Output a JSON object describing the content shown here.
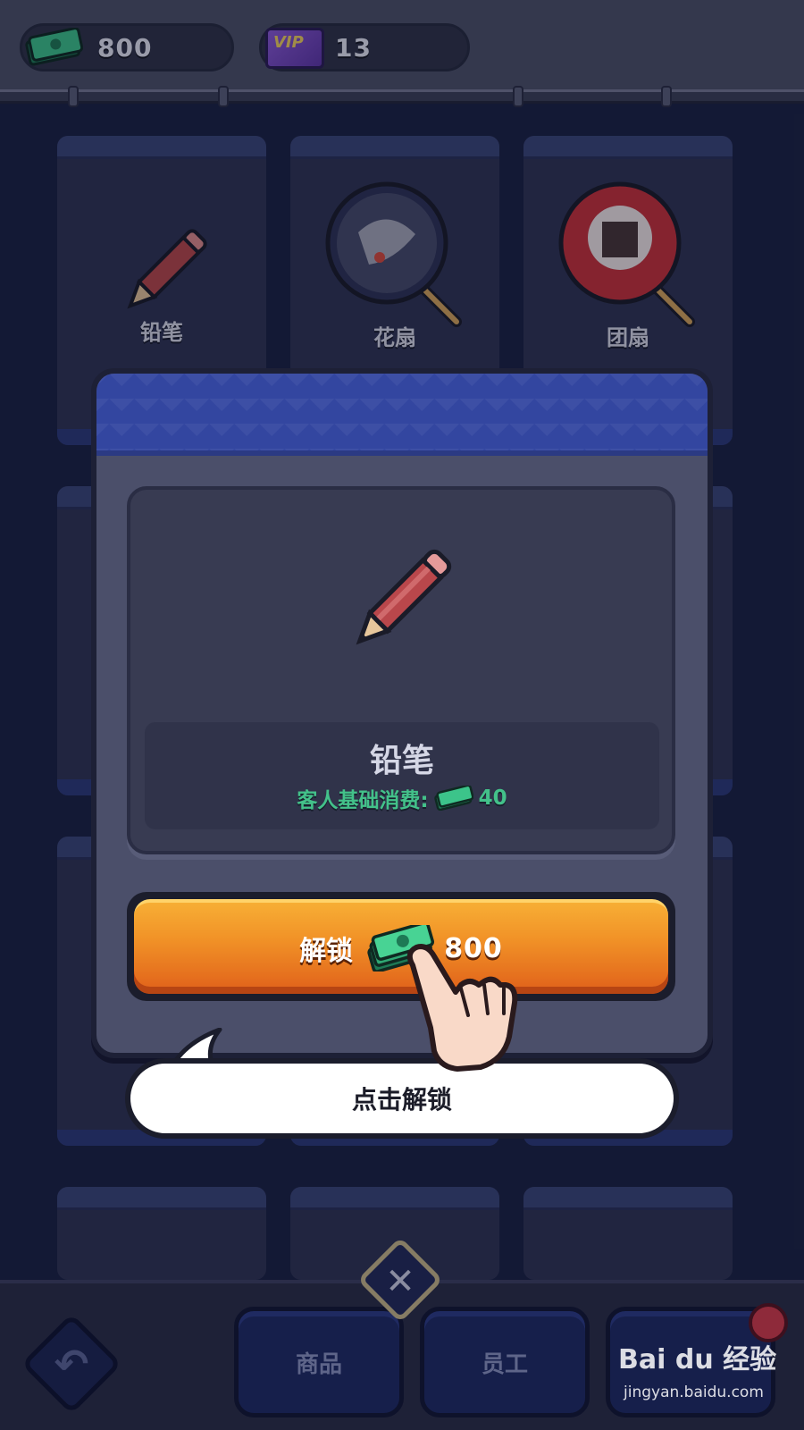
{
  "resources": {
    "money": "800",
    "vip_badge": "VIP",
    "vip_level": "13"
  },
  "cards": [
    {
      "name": "铅笔"
    },
    {
      "name": "花扇"
    },
    {
      "name": "团扇"
    }
  ],
  "modal": {
    "item_name": "铅笔",
    "cost_label": "客人基础消费:",
    "cost_value": "40",
    "unlock_label": "解锁",
    "unlock_price": "800"
  },
  "hint": {
    "text": "点击解锁"
  },
  "bottom_nav": {
    "tab_goods": "商品",
    "tab_staff": "员工",
    "close_symbol": "✕",
    "back_symbol": "↶"
  },
  "watermark": {
    "logo": "Bai du 经验",
    "url": "jingyan.baidu.com"
  },
  "colors": {
    "accent_orange": "#f19227",
    "cash_green": "#43c18a",
    "panel_blue": "#3346a0"
  }
}
